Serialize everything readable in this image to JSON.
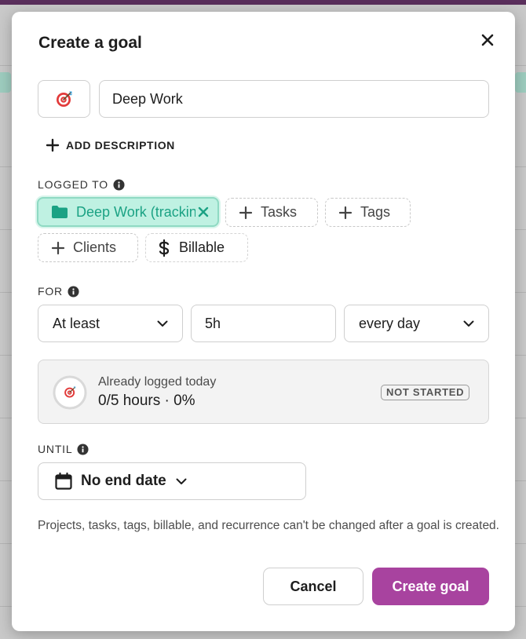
{
  "modal": {
    "title": "Create a goal",
    "close_icon": "close-icon",
    "goal_icon": "target-icon",
    "goal_name": "Deep Work",
    "add_description_label": "ADD DESCRIPTION"
  },
  "logged_to": {
    "label": "LOGGED TO",
    "project": {
      "name": "Deep Work (tracking)",
      "color": "#1ba284"
    },
    "chips": {
      "tasks": "Tasks",
      "tags": "Tags",
      "clients": "Clients",
      "billable": "Billable"
    }
  },
  "for": {
    "label": "FOR",
    "comparison": "At least",
    "amount": "5h",
    "recurrence": "every day"
  },
  "progress": {
    "label": "Already logged today",
    "value": "0/5 hours · 0%",
    "fraction": 0,
    "status": "NOT STARTED"
  },
  "until": {
    "label": "UNTIL",
    "value": "No end date"
  },
  "note": "Projects, tasks, tags, billable, and recurrence can't be changed after a goal is created.",
  "actions": {
    "cancel": "Cancel",
    "create": "Create goal"
  },
  "colors": {
    "accent": "#a8439f",
    "project_bg": "#bff1e2"
  }
}
